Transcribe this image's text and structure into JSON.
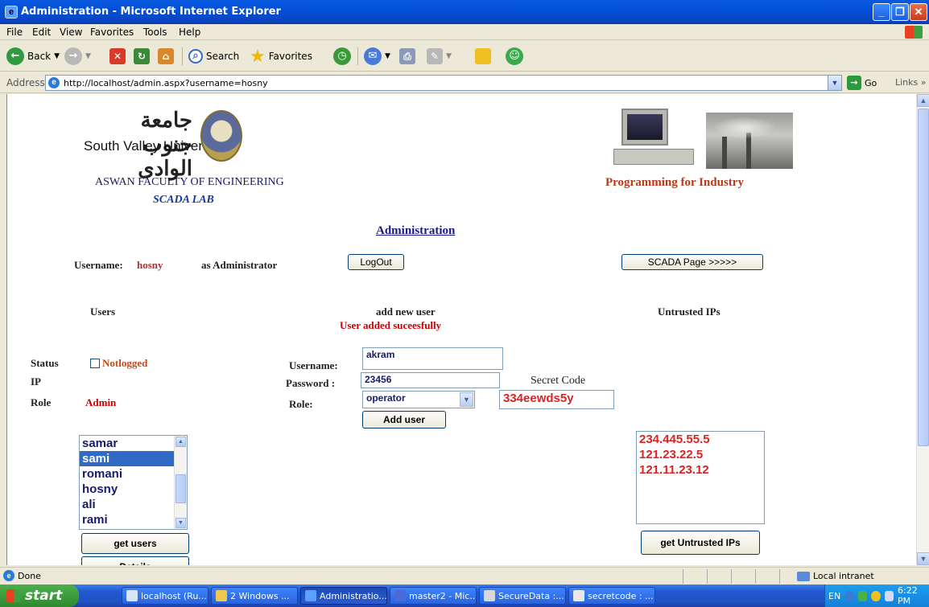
{
  "window": {
    "title": "Administration - Microsoft Internet Explorer",
    "minimize": "_",
    "maximize": "❐",
    "close": "✕"
  },
  "menu": [
    "File",
    "Edit",
    "View",
    "Favorites",
    "Tools",
    "Help"
  ],
  "toolbar": {
    "back": "Back",
    "search": "Search",
    "favorites": "Favorites"
  },
  "address": {
    "label": "Address",
    "url": "http://localhost/admin.aspx?username=hosny",
    "go": "Go",
    "links": "Links"
  },
  "header": {
    "university_arabic": "جامعة جنوب الوادى",
    "university_name": "South Valley University",
    "faculty": "ASWAN FACULTY OF ENGINEERING",
    "lab": "SCADA LAB",
    "programming": "Programming for Industry"
  },
  "admin": {
    "heading": "Administration",
    "username_label": "Username:",
    "username_value": "hosny",
    "as_admin": "as  Administrator",
    "logout": "LogOut",
    "scada_page": "SCADA Page >>>>>"
  },
  "sections": {
    "users": "Users",
    "add_new_user": "add new user",
    "added_msg": "User added suceesfully",
    "untrusted": "Untrusted  IPs"
  },
  "user_info": {
    "status_label": "Status",
    "status_value": "Notlogged",
    "ip_label": "IP",
    "role_label": "Role",
    "role_value": "Admin"
  },
  "form": {
    "username_label": "Username:",
    "username_value": "akram",
    "password_label": "Password  :",
    "password_value": "23456",
    "secret_code_label": "Secret Code",
    "secret_code_value": "334eewds5y",
    "role_label": "Role:",
    "role_value": "operator",
    "add_user": "Add user"
  },
  "users_list": {
    "items": [
      "samar",
      "sami",
      "romani",
      "hosny",
      "ali",
      "rami"
    ],
    "selected": "sami",
    "get_users": "get users",
    "details": "Details"
  },
  "ips_list": {
    "items": [
      "234.445.55.5",
      "121.23.22.5",
      "121.11.23.12"
    ],
    "get_ips": "get Untrusted IPs"
  },
  "status": {
    "text": "Done",
    "zone": "Local intranet"
  },
  "taskbar": {
    "start": "start",
    "tasks": [
      "localhost (Ru...",
      "2 Windows ...",
      "Administratio...",
      "master2 - Mic...",
      "SecureData :...",
      "secretcode : ..."
    ],
    "lang": "EN",
    "time": "6:22 PM"
  },
  "colors": {
    "accent_red": "#cc0000",
    "link_navy": "#1a1a8a",
    "list_selection": "#316ac5"
  }
}
